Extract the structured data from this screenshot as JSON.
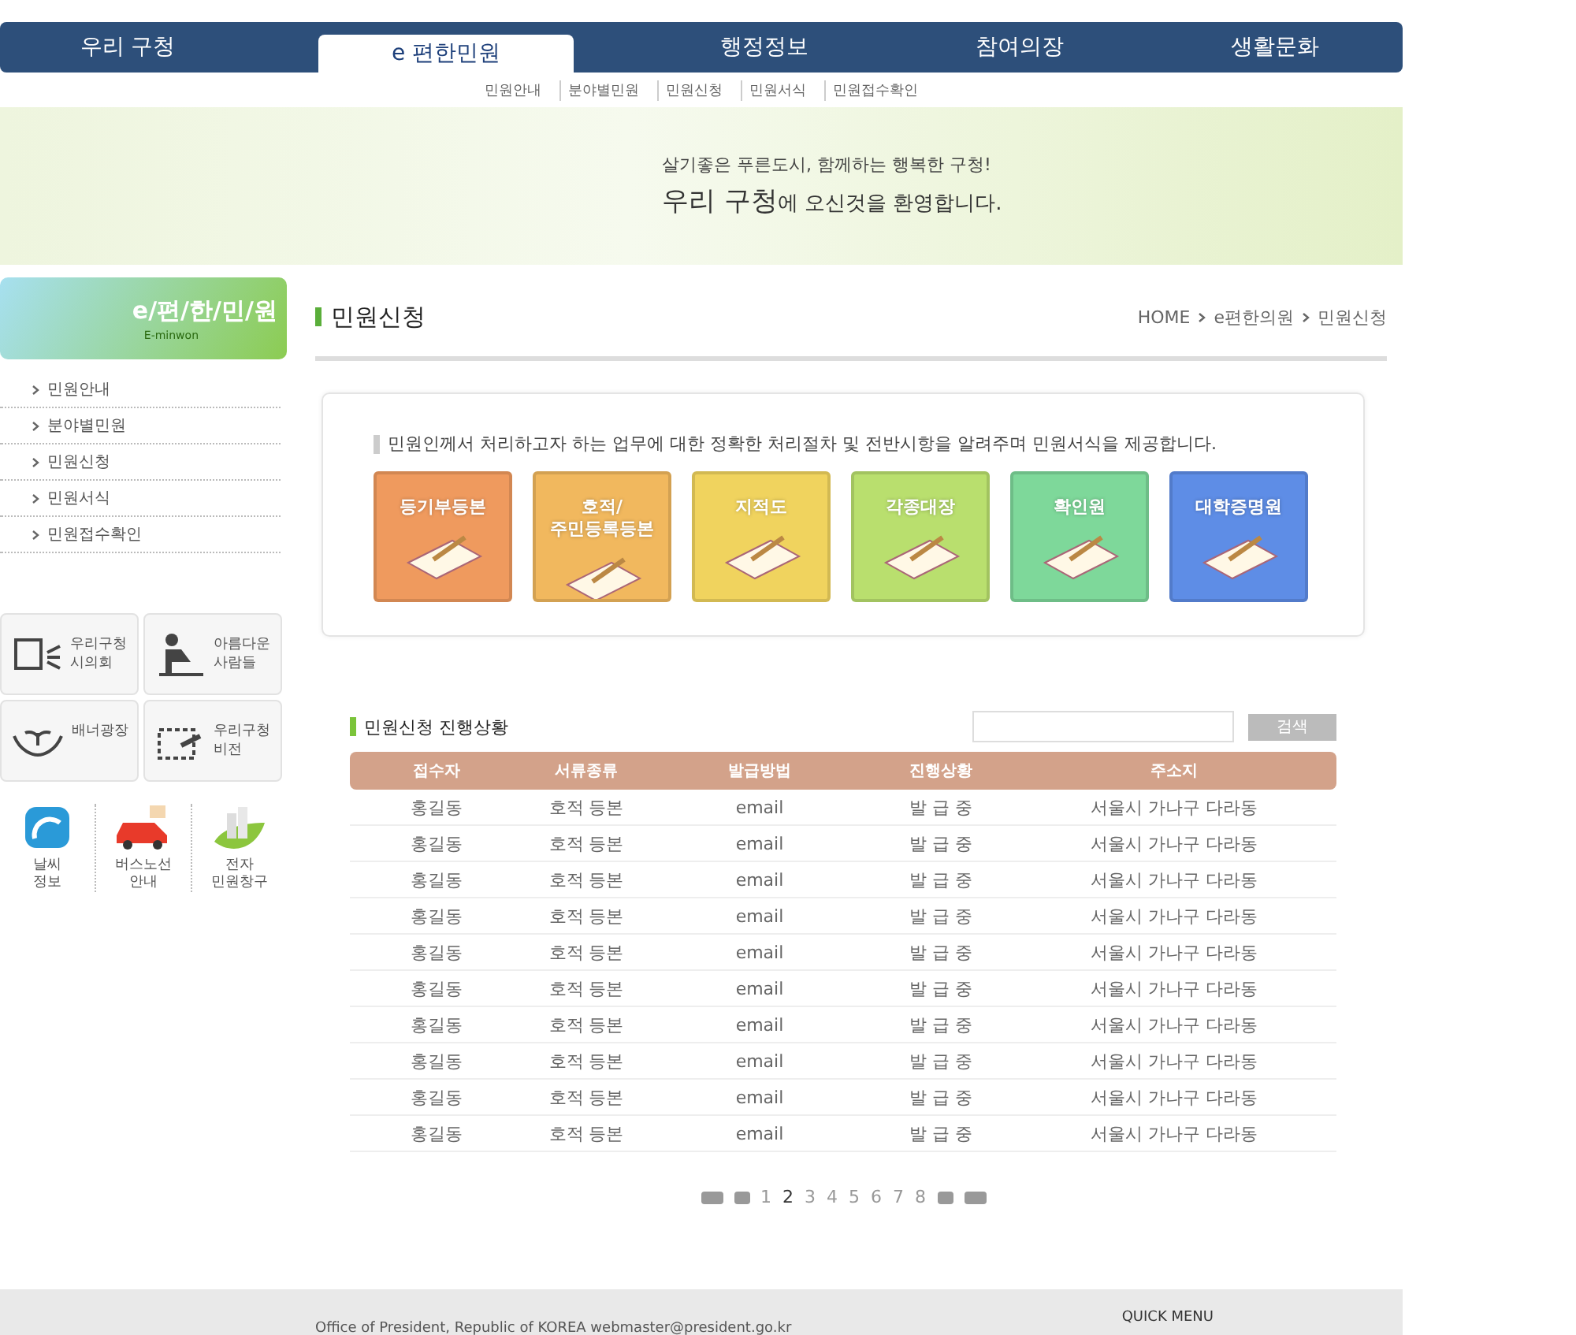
{
  "nav": [
    {
      "label": "우리 구청",
      "selected": false
    },
    {
      "label": "e 편한민원",
      "selected": true
    },
    {
      "label": "행정정보",
      "selected": false
    },
    {
      "label": "참여의장",
      "selected": false
    },
    {
      "label": "생활문화",
      "selected": false
    }
  ],
  "submenu": [
    "민원안내",
    "분야별민원",
    "민원신청",
    "민원서식",
    "민원접수확인"
  ],
  "banner": {
    "tagline": "살기좋은 푸른도시, 함께하는 행복한 구청!",
    "welcome": "**우리 구청**에 오신것을 환영합니다."
  },
  "sidebar": {
    "title": "e/편/한/민/원",
    "subtitle": "E-minwon",
    "items": [
      "민원안내",
      "분야별민원",
      "민원신청",
      "민원서식",
      "민원접수확인"
    ],
    "quick_links": [
      {
        "kind": "speech",
        "lines": [
          "우리구청",
          "시의회"
        ]
      },
      {
        "kind": "person",
        "lines": [
          "아름다운",
          "사람들"
        ]
      },
      {
        "kind": "hands",
        "lines": [
          "배너광장"
        ]
      },
      {
        "kind": "screen",
        "lines": [
          "우리구청",
          "비전"
        ]
      }
    ],
    "services": [
      {
        "kind": "weather",
        "lines": [
          "날씨",
          "정보"
        ]
      },
      {
        "kind": "car",
        "lines": [
          "버스노선",
          "안내"
        ]
      },
      {
        "kind": "city",
        "lines": [
          "전자",
          "민원창구"
        ]
      }
    ]
  },
  "page": {
    "title": "민원신청",
    "breadcrumb": [
      "HOME",
      "e편한의원",
      "민원신청"
    ]
  },
  "intro": "민원인께서 처리하고자 하는 업무에 대한 정확한 처리절차 및 전반시항을 알려주며 민원서식을 제공합니다.",
  "tiles": [
    {
      "label": "등기부등본",
      "color": "#ef9a5e"
    },
    {
      "label": "호적/\n주민등록등본",
      "color": "#f1b85e"
    },
    {
      "label": "지적도",
      "color": "#f0d35e"
    },
    {
      "label": "각종대장",
      "color": "#b9df6e"
    },
    {
      "label": "확인원",
      "color": "#7ed89a"
    },
    {
      "label": "대학증명원",
      "color": "#5e8de6"
    }
  ],
  "status": {
    "title": "민원신청 진행상황",
    "search_button": "검색",
    "columns": [
      "접수자",
      "서류종류",
      "발급방법",
      "진행상황",
      "주소지"
    ],
    "rows": [
      [
        "홍길동",
        "호적 등본",
        "email",
        "발 급 중",
        "서울시 가나구 다라동"
      ],
      [
        "홍길동",
        "호적 등본",
        "email",
        "발 급 중",
        "서울시 가나구 다라동"
      ],
      [
        "홍길동",
        "호적 등본",
        "email",
        "발 급 중",
        "서울시 가나구 다라동"
      ],
      [
        "홍길동",
        "호적 등본",
        "email",
        "발 급 중",
        "서울시 가나구 다라동"
      ],
      [
        "홍길동",
        "호적 등본",
        "email",
        "발 급 중",
        "서울시 가나구 다라동"
      ],
      [
        "홍길동",
        "호적 등본",
        "email",
        "발 급 중",
        "서울시 가나구 다라동"
      ],
      [
        "홍길동",
        "호적 등본",
        "email",
        "발 급 중",
        "서울시 가나구 다라동"
      ],
      [
        "홍길동",
        "호적 등본",
        "email",
        "발 급 중",
        "서울시 가나구 다라동"
      ],
      [
        "홍길동",
        "호적 등본",
        "email",
        "발 급 중",
        "서울시 가나구 다라동"
      ],
      [
        "홍길동",
        "호적 등본",
        "email",
        "발 급 중",
        "서울시 가나구 다라동"
      ]
    ],
    "pages": [
      {
        "label": "1",
        "selected": false
      },
      {
        "label": "2",
        "selected": true
      },
      {
        "label": "3",
        "selected": false
      },
      {
        "label": "4",
        "selected": false
      },
      {
        "label": "5",
        "selected": false
      },
      {
        "label": "6",
        "selected": false
      },
      {
        "label": "7",
        "selected": false
      },
      {
        "label": "8",
        "selected": false
      }
    ]
  },
  "footer": {
    "text": "Office of President, Republic of KOREA  webmaster@president.go.kr",
    "quick_menu": "QUICK MENU"
  }
}
